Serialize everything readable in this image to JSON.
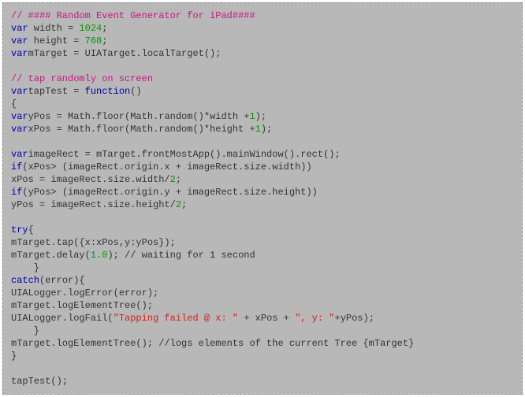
{
  "code_lines": [
    [
      {
        "c": "cm",
        "t": "// #### Random Event Generator for iPad####"
      }
    ],
    [
      {
        "c": "kw",
        "t": "var"
      },
      {
        "c": "",
        "t": " width = "
      },
      {
        "c": "nm",
        "t": "1024"
      },
      {
        "c": "",
        "t": ";"
      }
    ],
    [
      {
        "c": "kw",
        "t": "var"
      },
      {
        "c": "",
        "t": " height = "
      },
      {
        "c": "nm",
        "t": "768"
      },
      {
        "c": "",
        "t": ";"
      }
    ],
    [
      {
        "c": "kw",
        "t": "var"
      },
      {
        "c": "",
        "t": "mTarget = UIATarget.localTarget();"
      }
    ],
    [
      {
        "c": "",
        "t": ""
      }
    ],
    [
      {
        "c": "cm",
        "t": "// tap randomly on screen"
      }
    ],
    [
      {
        "c": "kw",
        "t": "var"
      },
      {
        "c": "",
        "t": "tapTest = "
      },
      {
        "c": "kw",
        "t": "function"
      },
      {
        "c": "",
        "t": "()"
      }
    ],
    [
      {
        "c": "",
        "t": "{"
      }
    ],
    [
      {
        "c": "kw",
        "t": "var"
      },
      {
        "c": "",
        "t": "yPos = Math.floor(Math.random()*width +"
      },
      {
        "c": "nm",
        "t": "1"
      },
      {
        "c": "",
        "t": ");"
      }
    ],
    [
      {
        "c": "kw",
        "t": "var"
      },
      {
        "c": "",
        "t": "xPos = Math.floor(Math.random()*height +"
      },
      {
        "c": "nm",
        "t": "1"
      },
      {
        "c": "",
        "t": ");"
      }
    ],
    [
      {
        "c": "",
        "t": ""
      }
    ],
    [
      {
        "c": "kw",
        "t": "var"
      },
      {
        "c": "",
        "t": "imageRect = mTarget.frontMostApp().mainWindow().rect();"
      }
    ],
    [
      {
        "c": "kw",
        "t": "if"
      },
      {
        "c": "",
        "t": "(xPos> (imageRect.origin.x + imageRect.size.width))"
      }
    ],
    [
      {
        "c": "",
        "t": "xPos = imageRect.size.width/"
      },
      {
        "c": "nm",
        "t": "2"
      },
      {
        "c": "",
        "t": ";"
      }
    ],
    [
      {
        "c": "kw",
        "t": "if"
      },
      {
        "c": "",
        "t": "(yPos> (imageRect.origin.y + imageRect.size.height))"
      }
    ],
    [
      {
        "c": "",
        "t": "yPos = imageRect.size.height/"
      },
      {
        "c": "nm",
        "t": "2"
      },
      {
        "c": "",
        "t": ";"
      }
    ],
    [
      {
        "c": "",
        "t": ""
      }
    ],
    [
      {
        "c": "kw",
        "t": "try"
      },
      {
        "c": "",
        "t": "{"
      }
    ],
    [
      {
        "c": "",
        "t": "mTarget.tap({x:xPos,y:yPos});"
      }
    ],
    [
      {
        "c": "",
        "t": "mTarget.delay("
      },
      {
        "c": "nm",
        "t": "1.0"
      },
      {
        "c": "",
        "t": "); // waiting for 1 second"
      }
    ],
    [
      {
        "c": "",
        "t": "    }"
      }
    ],
    [
      {
        "c": "kw",
        "t": "catch"
      },
      {
        "c": "",
        "t": "(error){"
      }
    ],
    [
      {
        "c": "",
        "t": "UIALogger.logError(error);"
      }
    ],
    [
      {
        "c": "",
        "t": "mTarget.logElementTree();"
      }
    ],
    [
      {
        "c": "",
        "t": "UIALogger.logFail("
      },
      {
        "c": "str",
        "t": "\"Tapping failed @ x: \""
      },
      {
        "c": "",
        "t": " + xPos + "
      },
      {
        "c": "str",
        "t": "\", y: \""
      },
      {
        "c": "",
        "t": "+yPos);"
      }
    ],
    [
      {
        "c": "",
        "t": "    }"
      }
    ],
    [
      {
        "c": "",
        "t": "mTarget.logElementTree(); //logs elements of the current Tree {mTarget}"
      }
    ],
    [
      {
        "c": "",
        "t": "}"
      }
    ],
    [
      {
        "c": "",
        "t": ""
      }
    ],
    [
      {
        "c": "",
        "t": "tapTest();"
      }
    ]
  ]
}
